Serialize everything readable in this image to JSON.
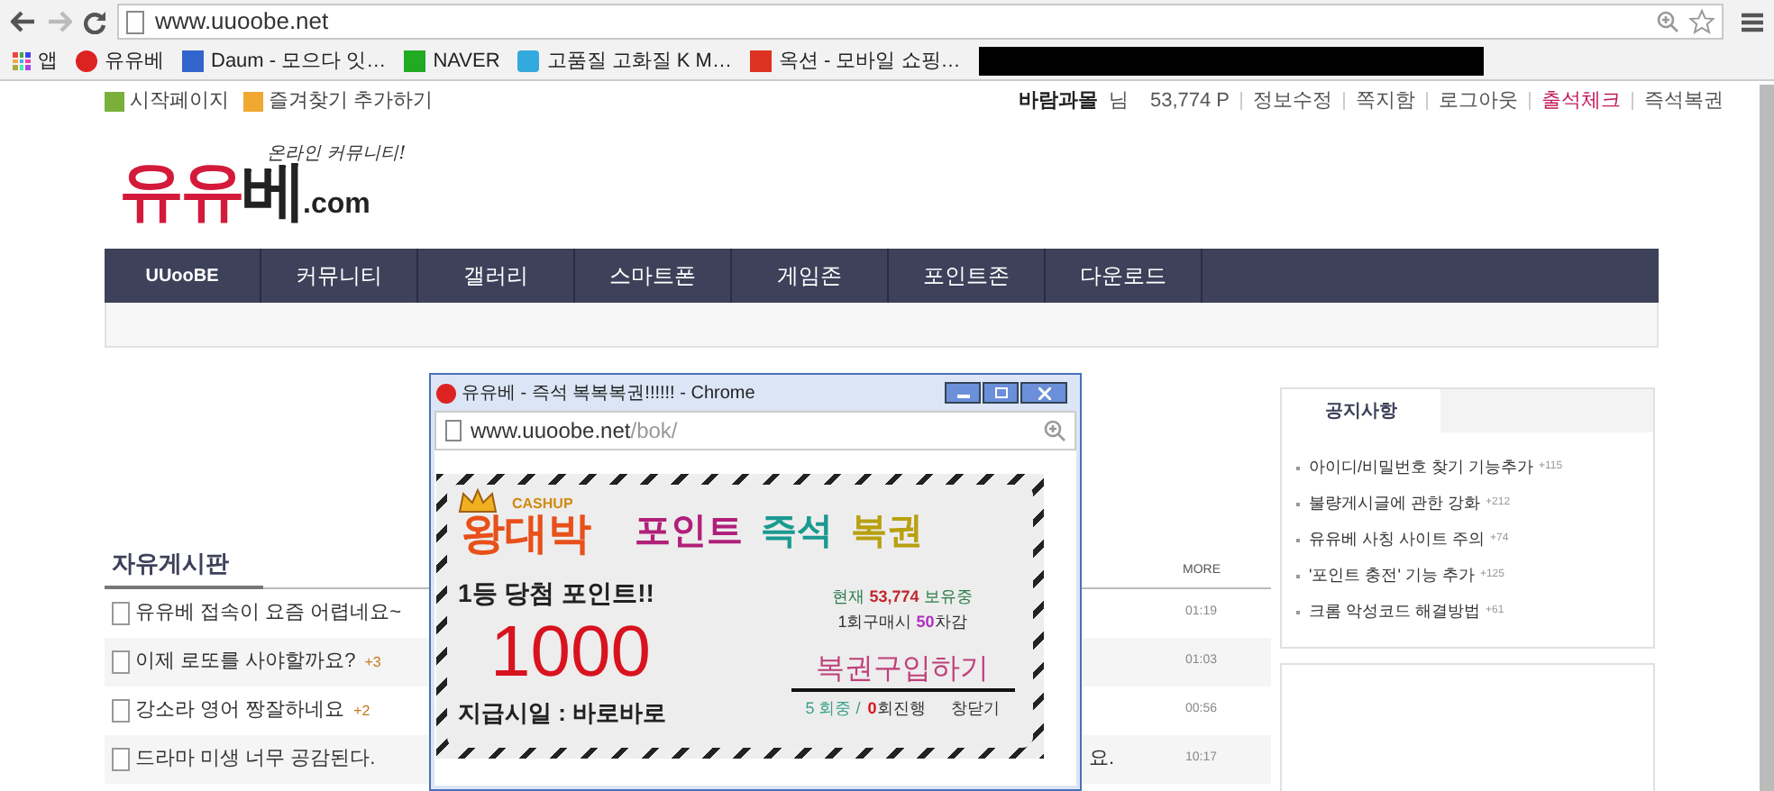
{
  "browser": {
    "url": "www.uuoobe.net",
    "apps_label": "앱",
    "bookmarks": [
      {
        "label": "유유베"
      },
      {
        "label": "Daum - 모으다 잇…"
      },
      {
        "label": "NAVER"
      },
      {
        "label": "고품질 고화질 K M…"
      },
      {
        "label": "옥션 - 모바일 쇼핑…"
      }
    ]
  },
  "top_bar": {
    "quick_links": [
      {
        "label": "시작페이지"
      },
      {
        "label": "즐겨찾기 추가하기"
      }
    ],
    "user_name": "바람과몰",
    "user_suffix": "님",
    "points": "53,774 P",
    "links": [
      {
        "label": "정보수정",
        "highlight": false
      },
      {
        "label": "쪽지함",
        "highlight": false
      },
      {
        "label": "로그아웃",
        "highlight": false
      },
      {
        "label": "출석체크",
        "highlight": true
      },
      {
        "label": "즉석복권",
        "highlight": false
      }
    ]
  },
  "logo": {
    "main": "유유베",
    "domain": ".com",
    "tagline": "온라인 커뮤니티!"
  },
  "nav": [
    {
      "label": "UUooBE"
    },
    {
      "label": "커뮤니티"
    },
    {
      "label": "갤러리"
    },
    {
      "label": "스마트폰"
    },
    {
      "label": "게임존"
    },
    {
      "label": "포인트존"
    },
    {
      "label": "다운로드"
    }
  ],
  "board": {
    "title": "자유게시판",
    "more": "MORE",
    "posts": [
      {
        "title": "유유베 접속이 요즘 어렵네요~",
        "time": "01:19"
      },
      {
        "title": "이제 로또를 사야할까요?",
        "comments": "+3",
        "time": "01:03"
      },
      {
        "title": "강소라 영어 짱잘하네요",
        "comments": "+2",
        "time": "00:56"
      },
      {
        "title": "드라마 미생 너무 공감된다.",
        "tail": "요.",
        "time": "10:17"
      }
    ]
  },
  "notice": {
    "tab": "공지사항",
    "items": [
      {
        "title": "아이디/비밀번호 찾기 기능추가",
        "count": "+115"
      },
      {
        "title": "불량게시글에 관한 강화",
        "count": "+212"
      },
      {
        "title": "유유베 사칭 사이트 주의",
        "count": "+74"
      },
      {
        "title": "'포인트 충전' 기능 추가",
        "count": "+125"
      },
      {
        "title": "크롬 악성코드 해결방법",
        "count": "+61"
      }
    ]
  },
  "popup": {
    "title": "유유베 - 즉석 복복복권!!!!!! - Chrome",
    "url_host": "www.uuoobe.net",
    "url_path": "/bok/",
    "banner": {
      "brand_small": "CASHUP",
      "brand": "왕대박",
      "heading_words": [
        "포인트",
        "즉석",
        "복권"
      ],
      "prize_label": "1등 당첨 포인트!!",
      "prize": "1000",
      "payout": "지급시일 : 바로바로",
      "balance": "현재 **53,774** 보유중",
      "cost": "1회구매시 **50**차감",
      "buy": "복권구입하기",
      "progress_total": "5 회중 /",
      "progress_now": "0",
      "progress_suffix": "회진행",
      "close": "창닫기"
    }
  }
}
